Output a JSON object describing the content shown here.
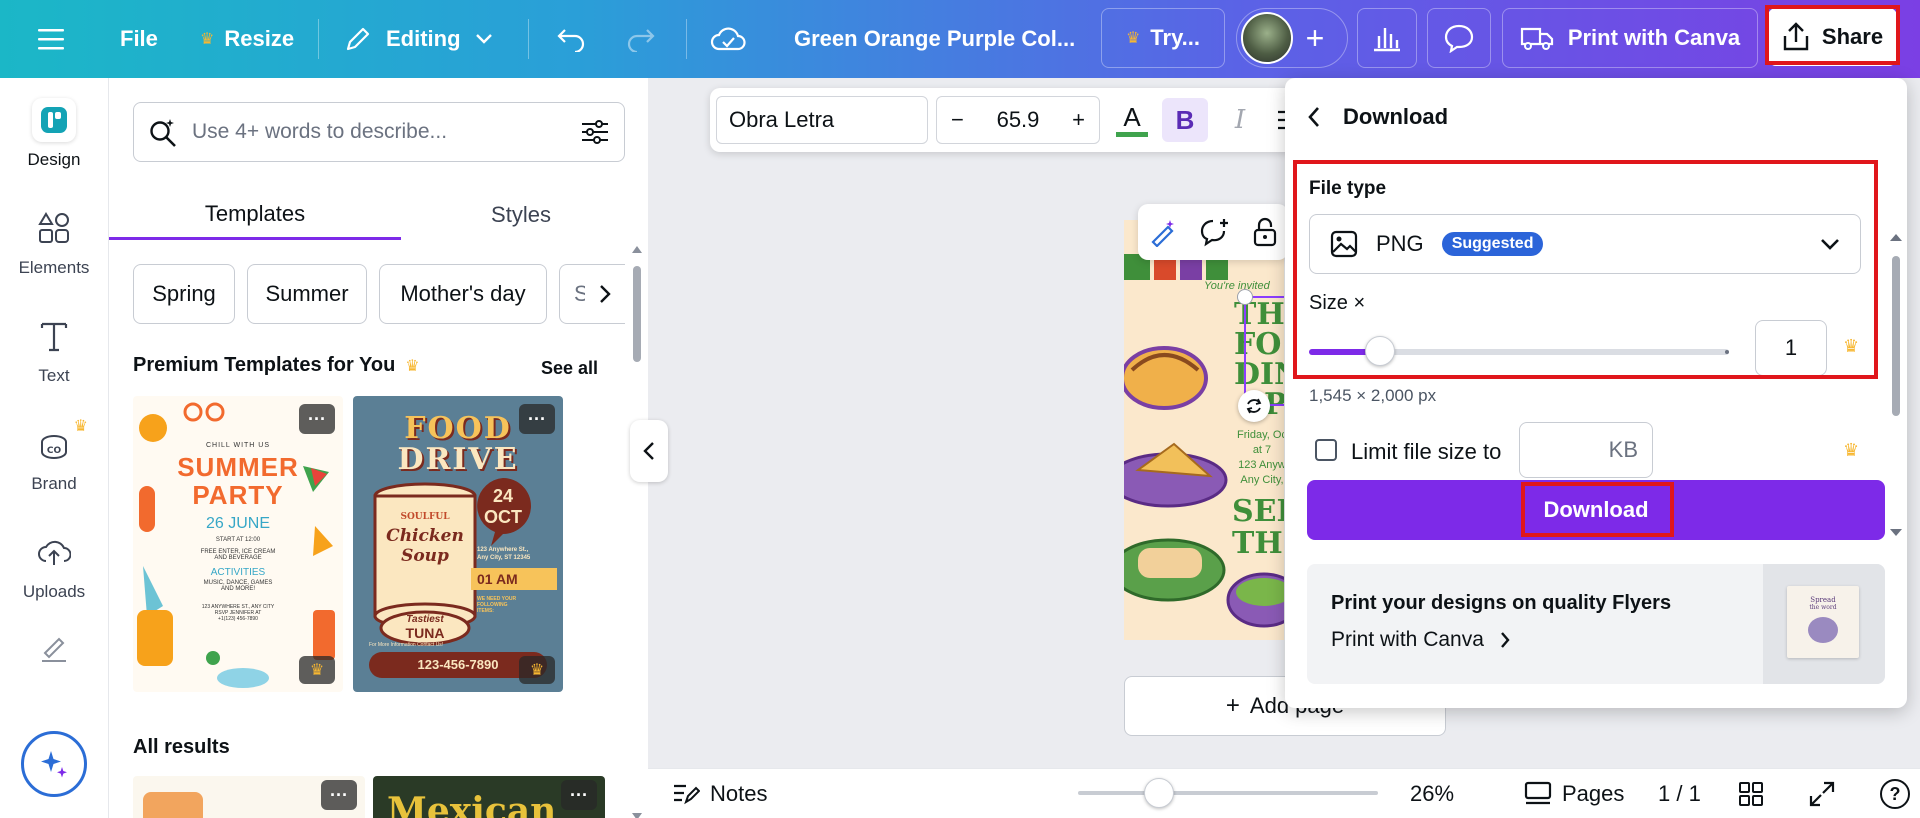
{
  "topbar": {
    "file": "File",
    "resize": "Resize",
    "editing": "Editing",
    "design_title": "Green Orange Purple Col...",
    "try": "Try...",
    "print": "Print with Canva",
    "share": "Share"
  },
  "rail": {
    "items": [
      "Design",
      "Elements",
      "Text",
      "Brand",
      "Uploads"
    ]
  },
  "panel": {
    "search_placeholder": "Use 4+ words to describe...",
    "tabs": [
      "Templates",
      "Styles"
    ],
    "chips": [
      "Spring",
      "Summer",
      "Mother's day",
      "Sy"
    ],
    "premium_title": "Premium Templates for You",
    "see_all": "See all",
    "all_results": "All results",
    "thumb1": {
      "l1": "CHILL WITH US",
      "l2": "SUMMER",
      "l3": "PARTY",
      "l4": "26 JUNE",
      "l5": "START AT 12:00",
      "l6": "FREE ENTER, ICE CREAM",
      "l7": "AND BEVERAGE",
      "l8": "ACTIVITIES",
      "l9": "MUSIC, DANCE, GAMES",
      "l10": "AND MORE!",
      "l11": "123 ANYWHERE ST., ANY CITY",
      "l12": "RSVP JENNIFER AT",
      "l13": "+1(123) 456-7890"
    },
    "thumb2": {
      "l1": "FOOD",
      "l2": "DRIVE",
      "l3": "SOULFUL",
      "l4": "Chicken",
      "l5": "Soup",
      "l6": "Tastiest",
      "l7": "TUNA",
      "l8": "24",
      "l9": "OCT",
      "l10": "123 Anywhere St.,",
      "l11": "Any City, ST 12345",
      "l12": "01 AM",
      "l13": "WE NEED YOUR",
      "l14": "FOLLOWING",
      "l15": "ITEMS:",
      "l16": "For More Information Contact Us!",
      "l17": "123-456-7890"
    },
    "thumb4": "Mexican"
  },
  "toolbar": {
    "font": "Obra Letra",
    "minus": "−",
    "size": "65.9",
    "plus": "+",
    "color_letter": "A",
    "bold": "B",
    "italic": "I"
  },
  "design": {
    "invited": "You're invited",
    "l1": "TH",
    "l2": "FO",
    "l3": "DINI",
    "l4": "P",
    "date": "Friday, Oc",
    "time": "at 7",
    "addr1": "123 Anyw",
    "addr2": "Any City,",
    "see1": "SEE",
    "see2": "THE"
  },
  "canvas": {
    "add_page": "Add page"
  },
  "bottombar": {
    "notes": "Notes",
    "zoom": "26%",
    "pages": "Pages",
    "page_count": "1 / 1"
  },
  "download": {
    "title": "Download",
    "file_type_label": "File type",
    "file_type": "PNG",
    "suggested": "Suggested",
    "size_label": "Size ×",
    "size_value": "1",
    "size_level": 0.17,
    "dimensions": "1,545 × 2,000 px",
    "limit_label": "Limit file size to",
    "kb": "KB",
    "button": "Download",
    "promo_title": "Print your designs on quality Flyers",
    "promo_link": "Print with Canva",
    "promo_card_l1": "Spread",
    "promo_card_l2": "the word"
  },
  "colors": {
    "accent": "#7d2ae8",
    "highlight": "#e0161b",
    "badge": "#2b64d9",
    "crown": "#f7b731"
  }
}
